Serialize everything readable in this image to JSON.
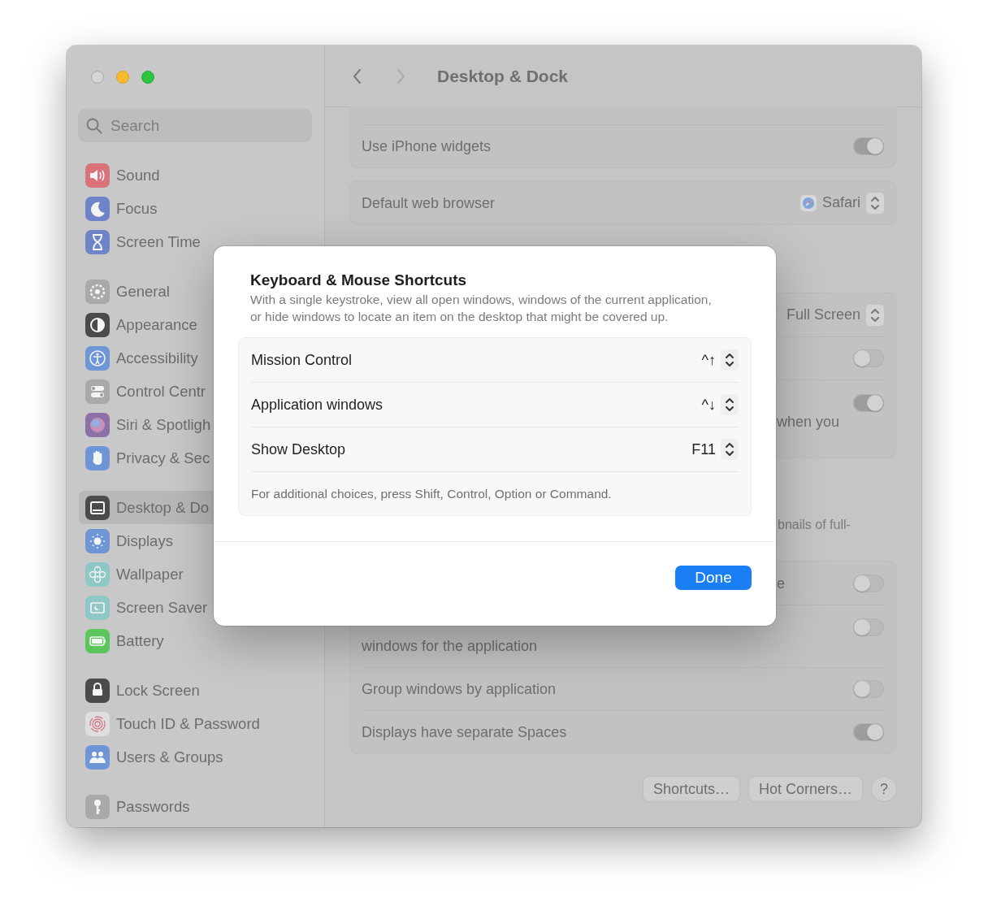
{
  "window": {
    "traffic_lights": [
      {
        "kind": "close",
        "color": "#d4d4d4"
      },
      {
        "kind": "minimize",
        "color": "#f7b92f"
      },
      {
        "kind": "zoom",
        "color": "#2bc640"
      }
    ]
  },
  "sidebar": {
    "search": {
      "placeholder": "Search"
    },
    "groups": [
      {
        "items": [
          {
            "label": "Sound",
            "color": "#d8737c",
            "selected": false
          },
          {
            "label": "Focus",
            "color": "#6f84c8",
            "selected": false
          },
          {
            "label": "Screen Time",
            "color": "#6f84c8",
            "selected": false
          }
        ]
      },
      {
        "items": [
          {
            "label": "General",
            "color": "#a9a9a9",
            "selected": false
          },
          {
            "label": "Appearance",
            "color": "#4b4b4b",
            "selected": false
          },
          {
            "label": "Accessibility",
            "color": "#6e95d6",
            "selected": false
          },
          {
            "label": "Control Centr",
            "color": "#a9a9a9",
            "selected": false
          },
          {
            "label": "Siri & Spotligh",
            "color": "#8b72a6",
            "selected": false
          },
          {
            "label": "Privacy & Sec",
            "color": "#6e95d6",
            "selected": false
          }
        ]
      },
      {
        "items": [
          {
            "label": "Desktop & Do",
            "color": "#4b4b4b",
            "selected": true
          },
          {
            "label": "Displays",
            "color": "#6e95d6",
            "selected": false
          },
          {
            "label": "Wallpaper",
            "color": "#8fc6c6",
            "selected": false
          },
          {
            "label": "Screen Saver",
            "color": "#8fc6c6",
            "selected": false
          },
          {
            "label": "Battery",
            "color": "#5cc65c",
            "selected": false
          }
        ]
      },
      {
        "items": [
          {
            "label": "Lock Screen",
            "color": "#4b4b4b",
            "selected": false
          },
          {
            "label": "Touch ID & Password",
            "color": "#dedede",
            "selected": false
          },
          {
            "label": "Users & Groups",
            "color": "#6e95d6",
            "selected": false
          }
        ]
      },
      {
        "items": [
          {
            "label": "Passwords",
            "color": "#a9a9a9",
            "selected": false
          }
        ]
      }
    ]
  },
  "header": {
    "back": {
      "disabled": false
    },
    "forward": {
      "disabled": true
    },
    "title": "Desktop & Dock"
  },
  "content": [
    {
      "kind": "card",
      "clipped": true,
      "rows": [
        {
          "kind": "toggle",
          "label": "Use iPhone widgets",
          "on": true
        }
      ]
    },
    {
      "kind": "card",
      "rows": [
        {
          "kind": "popup",
          "label": "Default web browser",
          "value": "Safari",
          "app_icon": true
        }
      ]
    },
    {
      "kind": "card",
      "rows": [
        {
          "kind": "popup",
          "value": "Full Screen"
        },
        {
          "kind": "toggle",
          "on": false
        },
        {
          "kind": "toggle",
          "fragment": "when you",
          "second_line": true,
          "on": true
        }
      ]
    },
    {
      "kind": "note",
      "fragment": "bnails of full-"
    },
    {
      "kind": "card",
      "rows": [
        {
          "kind": "toggle",
          "fragment": "e",
          "on": false
        },
        {
          "kind": "toggle",
          "label": "windows for the application",
          "second_line": true,
          "on": false
        },
        {
          "kind": "toggle",
          "label": "Group windows by application",
          "on": false
        },
        {
          "kind": "toggle",
          "label": "Displays have separate Spaces",
          "on": true
        }
      ]
    }
  ],
  "footer_buttons": [
    {
      "kind": "shortcuts",
      "label": "Shortcuts…"
    },
    {
      "kind": "hot_corners",
      "label": "Hot Corners…"
    },
    {
      "kind": "help",
      "label": "?"
    }
  ],
  "dialog": {
    "title": "Keyboard & Mouse Shortcuts",
    "description": "With a single keystroke, view all open windows, windows of the current application, or hide windows to locate an item on the desktop that might be covered up.",
    "shortcuts": [
      {
        "label": "Mission Control",
        "keys": "^↑"
      },
      {
        "label": "Application windows",
        "keys": "^↓"
      },
      {
        "label": "Show Desktop",
        "keys": "F11"
      }
    ],
    "note": "For additional choices, press Shift, Control, Option or Command.",
    "done": "Done"
  }
}
